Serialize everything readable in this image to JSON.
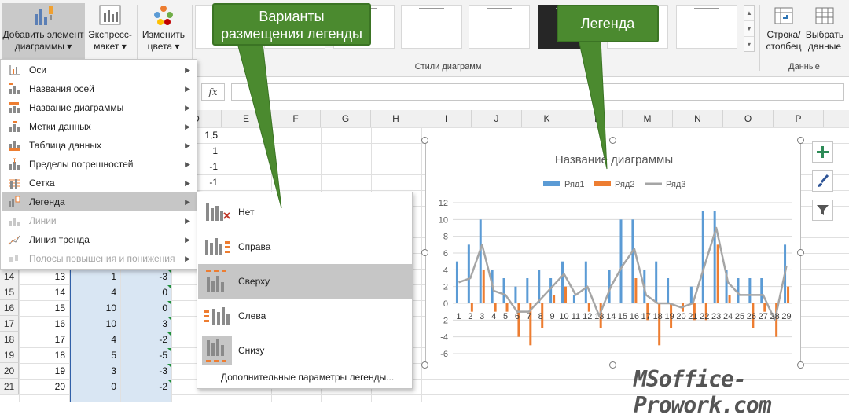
{
  "ribbon": {
    "add_element": {
      "line1": "Добавить элемент",
      "line2": "диаграммы ▾"
    },
    "quick_layout": {
      "line1": "Экспресс-",
      "line2": "макет ▾"
    },
    "change_colors": {
      "line1": "Изменить",
      "line2": "цвета ▾"
    },
    "styles_group_label": "Стили диаграмм",
    "switch_row_col": {
      "line1": "Строка/",
      "line2": "столбец"
    },
    "select_data": {
      "line1": "Выбрать",
      "line2": "данные"
    },
    "data_group_label": "Данные"
  },
  "formula_bar": {
    "fx_label": "fx"
  },
  "columns": [
    "D",
    "E",
    "F",
    "G",
    "H",
    "I",
    "J",
    "K",
    "L",
    "M",
    "N",
    "O",
    "P"
  ],
  "top_cells": [
    "1,5",
    "1",
    "-1",
    "-1"
  ],
  "rows": [
    {
      "num": "14",
      "a": "13",
      "b": "1",
      "c": "-3"
    },
    {
      "num": "15",
      "a": "14",
      "b": "4",
      "c": "0"
    },
    {
      "num": "16",
      "a": "15",
      "b": "10",
      "c": "0"
    },
    {
      "num": "17",
      "a": "16",
      "b": "10",
      "c": "3"
    },
    {
      "num": "18",
      "a": "17",
      "b": "4",
      "c": "-2"
    },
    {
      "num": "19",
      "a": "18",
      "b": "5",
      "c": "-5"
    },
    {
      "num": "20",
      "a": "19",
      "b": "3",
      "c": "-3"
    },
    {
      "num": "21",
      "a": "20",
      "b": "0",
      "c": "-2"
    }
  ],
  "menu": {
    "items": [
      {
        "label": "Оси",
        "icon": "axes-icon",
        "disabled": false
      },
      {
        "label": "Названия осей",
        "icon": "axis-titles-icon",
        "disabled": false
      },
      {
        "label": "Название диаграммы",
        "icon": "chart-title-icon",
        "disabled": false
      },
      {
        "label": "Метки данных",
        "icon": "data-labels-icon",
        "disabled": false
      },
      {
        "label": "Таблица данных",
        "icon": "data-table-icon",
        "disabled": false
      },
      {
        "label": "Пределы погрешностей",
        "icon": "error-bars-icon",
        "disabled": false
      },
      {
        "label": "Сетка",
        "icon": "gridlines-icon",
        "disabled": false
      },
      {
        "label": "Легенда",
        "icon": "legend-icon",
        "disabled": false
      },
      {
        "label": "Линии",
        "icon": "lines-icon",
        "disabled": true
      },
      {
        "label": "Линия тренда",
        "icon": "trendline-icon",
        "disabled": false
      },
      {
        "label": "Полосы повышения и понижения",
        "icon": "up-down-bars-icon",
        "disabled": true
      }
    ]
  },
  "legend_menu": {
    "items": [
      {
        "label": "Нет",
        "icon": "legend-none-icon"
      },
      {
        "label": "Справа",
        "icon": "legend-right-icon"
      },
      {
        "label": "Сверху",
        "icon": "legend-top-icon"
      },
      {
        "label": "Слева",
        "icon": "legend-left-icon"
      },
      {
        "label": "Снизу",
        "icon": "legend-bottom-icon"
      }
    ],
    "more": "Дополнительные параметры легенды..."
  },
  "callouts": {
    "placement": {
      "line1": "Варианты",
      "line2": "размещения легенды"
    },
    "legend": "Легенда"
  },
  "watermark": "MSoffice-Prowork.com",
  "colors": {
    "series1": "#5b9bd5",
    "series2": "#ed7d31",
    "series3": "#a5a5a5",
    "callout": "#4b8a2f"
  },
  "chart_data": {
    "type": "bar",
    "title": "Название диаграммы",
    "legend_position": "top",
    "categories": [
      "1",
      "2",
      "3",
      "4",
      "5",
      "6",
      "7",
      "8",
      "9",
      "10",
      "11",
      "12",
      "13",
      "14",
      "15",
      "16",
      "17",
      "18",
      "19",
      "20",
      "21",
      "22",
      "23",
      "24",
      "25",
      "26",
      "27",
      "28",
      "29"
    ],
    "series": [
      {
        "name": "Ряд1",
        "type": "bar",
        "values": [
          5,
          7,
          10,
          4,
          3,
          2,
          3,
          4,
          3,
          5,
          1,
          5,
          0,
          4,
          10,
          10,
          4,
          5,
          3,
          0,
          2,
          11,
          11,
          4,
          3,
          3,
          3,
          0,
          7
        ]
      },
      {
        "name": "Ряд2",
        "type": "bar",
        "values": [
          0,
          -1,
          4,
          -1,
          -1,
          -4,
          -5,
          -3,
          1,
          2,
          0,
          -1,
          -3,
          0,
          0,
          3,
          -2,
          -5,
          -3,
          -1,
          -2,
          -2,
          7,
          1,
          0,
          -3,
          -1,
          -4,
          2
        ]
      },
      {
        "name": "Ряд3",
        "type": "line",
        "values": [
          2.5,
          3,
          7,
          1.5,
          1,
          -1,
          -1,
          0.5,
          2,
          3.5,
          1,
          2,
          -1.5,
          2,
          4.5,
          6.5,
          1,
          0,
          0,
          -0.5,
          0,
          4.5,
          9,
          2.5,
          1,
          1,
          1,
          -2,
          4.5
        ]
      }
    ],
    "ylim": [
      -6,
      12
    ],
    "yticks": [
      -6,
      -4,
      -2,
      0,
      2,
      4,
      6,
      8,
      10,
      12
    ],
    "grid": true
  }
}
